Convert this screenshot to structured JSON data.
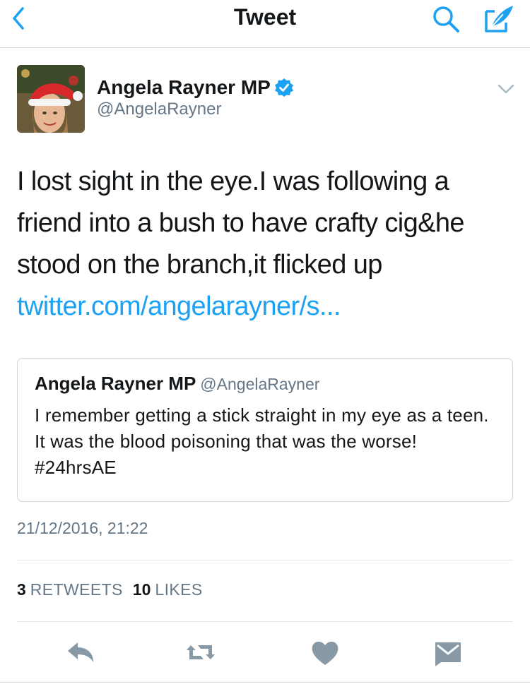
{
  "nav": {
    "title": "Tweet",
    "accent_color": "#1da1f2",
    "icons": [
      "back-chevron-icon",
      "search-icon",
      "compose-icon"
    ]
  },
  "tweet": {
    "author_name": "Angela Rayner MP",
    "author_handle": "@AngelaRayner",
    "verified": true,
    "text_lines": [
      "I lost sight in the eye.I was following a",
      "friend into a bush to have crafty cig&he",
      "stood on the branch,it flicked up"
    ],
    "link_text": "twitter.com/angelarayner/s...",
    "timestamp": "21/12/2016, 21:22",
    "retweets": "3",
    "retweets_label": "RETWEETS",
    "likes": "10",
    "likes_label": "LIKES"
  },
  "quoted_tweet": {
    "author_name": "Angela Rayner MP",
    "author_handle": "@AngelaRayner",
    "text": "I remember getting a stick straight in my eye as a teen. It was the blood poisoning that was the worse! #24hrsAE"
  },
  "actions": [
    "reply-icon",
    "retweet-icon",
    "like-icon",
    "direct-message-icon"
  ],
  "colors": {
    "link": "#1da1f2",
    "text": "#14171a",
    "secondary_text": "#657786",
    "icon_gray": "#8899a6"
  }
}
